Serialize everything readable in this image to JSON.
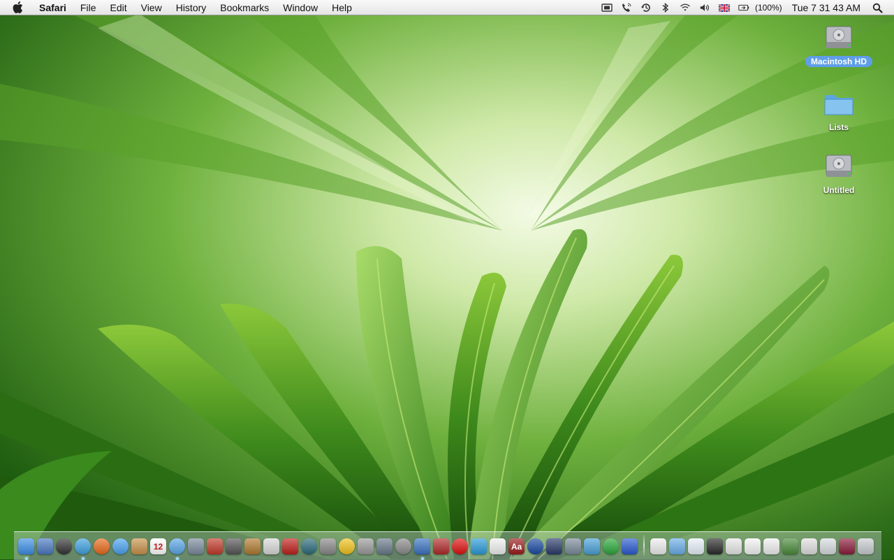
{
  "menubar": {
    "app_name": "Safari",
    "menus": [
      "File",
      "Edit",
      "View",
      "History",
      "Bookmarks",
      "Window",
      "Help"
    ],
    "status_icons": [
      "screen-record-icon",
      "phone-icon",
      "time-machine-icon",
      "bluetooth-icon",
      "wifi-icon",
      "volume-icon",
      "uk-flag-icon",
      "battery-icon"
    ],
    "battery_text": "(100%)",
    "clock": "Tue 7 31 43 AM"
  },
  "desktop": {
    "icons": [
      {
        "label": "Macintosh HD",
        "kind": "hard-drive-icon",
        "selected": true
      },
      {
        "label": "Lists",
        "kind": "folder-icon",
        "selected": false
      },
      {
        "label": "Untitled",
        "kind": "hard-drive-icon",
        "selected": false
      }
    ]
  },
  "dock": {
    "apps": [
      {
        "name": "finder-icon",
        "color": "#3d8ee6"
      },
      {
        "name": "preview-icon",
        "color": "#4a78c0"
      },
      {
        "name": "dashboard-icon",
        "color": "#333333"
      },
      {
        "name": "safari-icon",
        "color": "#3fa0e0"
      },
      {
        "name": "firefox-icon",
        "color": "#e86a1c"
      },
      {
        "name": "ichat-icon",
        "color": "#4aa2f0"
      },
      {
        "name": "address-book-icon",
        "color": "#c8924a"
      },
      {
        "name": "ical-icon",
        "color": "#ffffff",
        "text": "12"
      },
      {
        "name": "itunes-icon",
        "color": "#5aa6e8"
      },
      {
        "name": "iphoto-icon",
        "color": "#7a8a9c"
      },
      {
        "name": "photo-booth-icon",
        "color": "#c23a2a"
      },
      {
        "name": "imovie-icon",
        "color": "#555555"
      },
      {
        "name": "garageband-icon",
        "color": "#b07a30"
      },
      {
        "name": "ipod-icon",
        "color": "#d8d8d8"
      },
      {
        "name": "photo-book-icon",
        "color": "#c0201c"
      },
      {
        "name": "time-machine-app-icon",
        "color": "#2a6a7a"
      },
      {
        "name": "system-preferences-icon",
        "color": "#888888"
      },
      {
        "name": "adium-icon",
        "color": "#f2c21c"
      },
      {
        "name": "calculator-icon",
        "color": "#9a9a9a"
      },
      {
        "name": "xcode-icon",
        "color": "#6a7a8a"
      },
      {
        "name": "front-row-icon",
        "color": "#8a8a8a"
      },
      {
        "name": "mail-icon",
        "color": "#3a72c0"
      },
      {
        "name": "script-editor-icon",
        "color": "#b02a2a"
      },
      {
        "name": "vodafone-icon",
        "color": "#e01010"
      },
      {
        "name": "app-store-icon",
        "color": "#2a9ad8"
      },
      {
        "name": "textedit-icon",
        "color": "#f0f0f0"
      },
      {
        "name": "dictionary-icon",
        "color": "#9a1c1c",
        "text": "Aa"
      },
      {
        "name": "google-earth-icon",
        "color": "#1a4aa0"
      },
      {
        "name": "keynote-icon",
        "color": "#2a3a6a"
      },
      {
        "name": "image-capture-icon",
        "color": "#7a8a9a"
      },
      {
        "name": "network-icon",
        "color": "#4aa0d8"
      },
      {
        "name": "utorrent-icon",
        "color": "#2aa83a"
      },
      {
        "name": "bluetooth-app-icon",
        "color": "#2a5ad0"
      }
    ],
    "docs": [
      {
        "name": "document-icon",
        "color": "#eeeeee"
      },
      {
        "name": "folder-stack-icon",
        "color": "#6aaee8"
      },
      {
        "name": "music-file-icon",
        "color": "#e8f0f8"
      },
      {
        "name": "screenshot-icon",
        "color": "#2a2a2a"
      },
      {
        "name": "screenshot-icon",
        "color": "#e8e8e8"
      },
      {
        "name": "screenshot-icon",
        "color": "#f4f4f4"
      },
      {
        "name": "screenshot-icon",
        "color": "#f0f0f0"
      },
      {
        "name": "screenshot-icon",
        "color": "#4a8a3a"
      },
      {
        "name": "screenshot-icon",
        "color": "#e0e0e0"
      },
      {
        "name": "screenshot-icon",
        "color": "#d8dce0"
      },
      {
        "name": "screenshot-icon",
        "color": "#8a1c3a"
      },
      {
        "name": "trash-icon",
        "color": "#c8ccd0"
      }
    ]
  }
}
